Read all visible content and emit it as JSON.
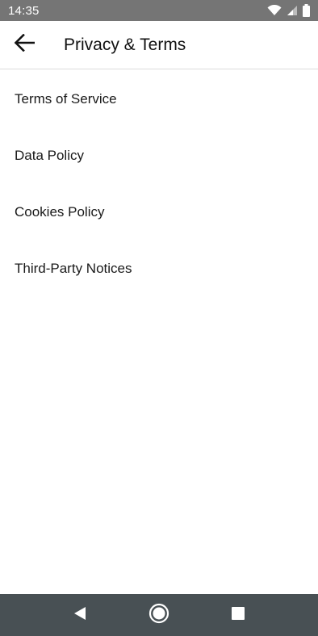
{
  "status_bar": {
    "time": "14:35",
    "icons": [
      "wifi-icon",
      "cell-signal-icon",
      "battery-icon"
    ]
  },
  "app_bar": {
    "back_icon": "arrow-back-icon",
    "title": "Privacy & Terms"
  },
  "menu": {
    "items": [
      {
        "label": "Terms of Service"
      },
      {
        "label": "Data Policy"
      },
      {
        "label": "Cookies Policy"
      },
      {
        "label": "Third-Party Notices"
      }
    ]
  },
  "nav_bar": {
    "buttons": [
      "back-triangle-icon",
      "home-circle-icon",
      "recents-square-icon"
    ]
  },
  "colors": {
    "status_bar_bg": "#757575",
    "nav_bar_bg": "#485054",
    "text": "#1a1a1a"
  }
}
